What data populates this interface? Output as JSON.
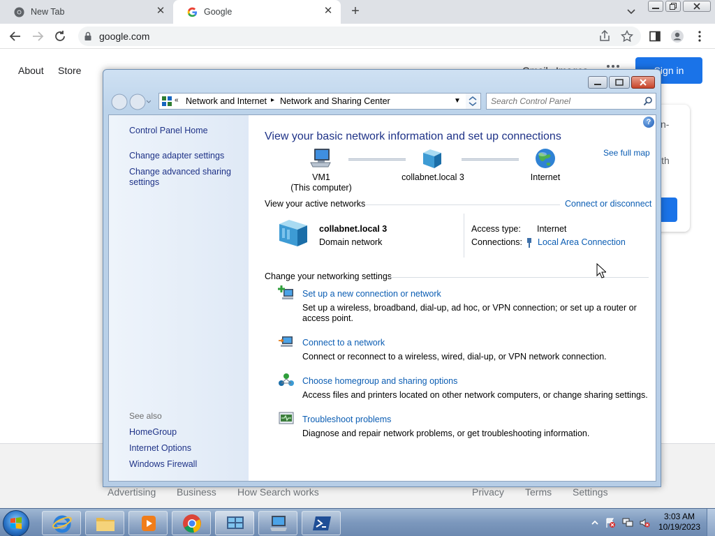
{
  "browser": {
    "tabs": [
      {
        "title": "New Tab",
        "favicon": "chrome-icon",
        "active": false
      },
      {
        "title": "Google",
        "favicon": "google-g-icon",
        "active": true
      }
    ],
    "url": "google.com"
  },
  "google": {
    "top_left_links": [
      "About",
      "Store"
    ],
    "top_right_links": [
      "Gmail",
      "Images"
    ],
    "signin_label": "Sign in",
    "popup_text": [
      "n-",
      "ith"
    ],
    "footer_links_left": [
      "Advertising",
      "Business",
      "How Search works"
    ],
    "footer_links_right": [
      "Privacy",
      "Terms",
      "Settings"
    ]
  },
  "control_panel": {
    "breadcrumb": [
      "Network and Internet",
      "Network and Sharing Center"
    ],
    "search_placeholder": "Search Control Panel",
    "left_nav": {
      "home": "Control Panel Home",
      "links": [
        "Change adapter settings",
        "Change advanced sharing settings"
      ],
      "see_also_title": "See also",
      "see_also": [
        "HomeGroup",
        "Internet Options",
        "Windows Firewall"
      ]
    },
    "title": "View your basic network information and set up connections",
    "see_full_map": "See full map",
    "map": {
      "computer_name": "VM1",
      "computer_sub": "(This computer)",
      "network_name": "collabnet.local  3",
      "internet": "Internet"
    },
    "active_networks": {
      "title": "View your active networks",
      "action": "Connect or disconnect",
      "network_name": "collabnet.local  3",
      "network_type": "Domain network",
      "access_type_label": "Access type:",
      "access_type_value": "Internet",
      "connections_label": "Connections:",
      "connections_value": "Local Area Connection"
    },
    "settings": {
      "title": "Change your networking settings",
      "tasks": [
        {
          "link": "Set up a new connection or network",
          "desc": "Set up a wireless, broadband, dial-up, ad hoc, or VPN connection; or set up a router or access point."
        },
        {
          "link": "Connect to a network",
          "desc": "Connect or reconnect to a wireless, wired, dial-up, or VPN network connection."
        },
        {
          "link": "Choose homegroup and sharing options",
          "desc": "Access files and printers located on other network computers, or change sharing settings."
        },
        {
          "link": "Troubleshoot problems",
          "desc": "Diagnose and repair network problems, or get troubleshooting information."
        }
      ]
    }
  },
  "taskbar": {
    "time": "3:03 AM",
    "date": "10/19/2023"
  }
}
